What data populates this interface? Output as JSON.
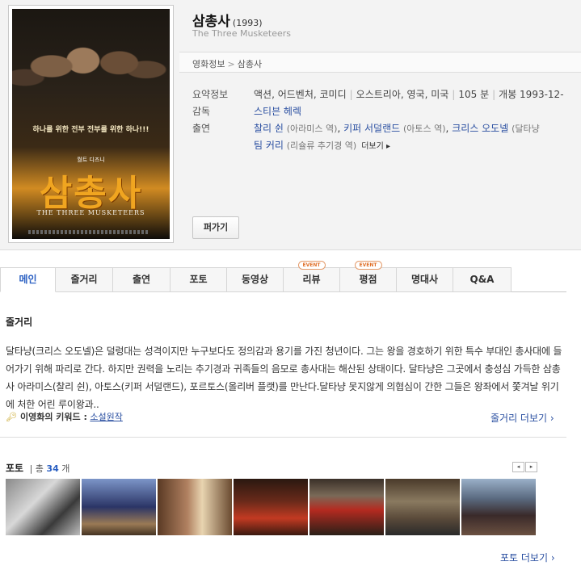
{
  "movie": {
    "title": "삼총사",
    "year": "(1993)",
    "original_title": "The Three Musketeers",
    "poster": {
      "tagline": "하나를 위한 전부 전부를 위한 하나!!!",
      "studio": "월트 디즈니",
      "logo_text": "삼총사",
      "english": "THE THREE MUSKETEERS"
    }
  },
  "breadcrumb": [
    "영화정보",
    "삼총사"
  ],
  "details": {
    "summary_label": "요약정보",
    "summary_items": [
      "액션, 어드벤처, 코미디",
      "오스트리아, 영국, 미국",
      "105 분",
      "개봉 1993-12-"
    ],
    "director_label": "감독",
    "director": "스티븐 헤렉",
    "cast_label": "출연",
    "cast_line1": [
      {
        "name": "찰리 쉰",
        "role": "(아라미스 역)"
      },
      {
        "name": "키퍼 서덜랜드",
        "role": "(아토스 역)"
      },
      {
        "name": "크리스 오도넬",
        "role": "(달타냥"
      }
    ],
    "cast_line2": [
      {
        "name": "팀 커리",
        "role": "(리슐류 추기경 역)"
      }
    ],
    "more_label": "더보기 ▸"
  },
  "share_button": "퍼가기",
  "tabs": [
    {
      "label": "메인",
      "active": true,
      "badge": ""
    },
    {
      "label": "줄거리",
      "active": false,
      "badge": ""
    },
    {
      "label": "출연",
      "active": false,
      "badge": ""
    },
    {
      "label": "포토",
      "active": false,
      "badge": ""
    },
    {
      "label": "동영상",
      "active": false,
      "badge": ""
    },
    {
      "label": "리뷰",
      "active": false,
      "badge": "EVENT"
    },
    {
      "label": "평점",
      "active": false,
      "badge": "EVENT"
    },
    {
      "label": "명대사",
      "active": false,
      "badge": ""
    },
    {
      "label": "Q&A",
      "active": false,
      "badge": ""
    }
  ],
  "synopsis": {
    "heading": "줄거리",
    "text": "달타냥(크리스 오도넬)은 덜렁대는 성격이지만 누구보다도 정의감과 용기를 가진 청년이다. 그는 왕을 경호하기 위한 특수 부대인 총사대에 들어가기 위해 파리로 간다. 하지만 권력을 노리는 추기경과 귀족들의 음모로 총사대는 해산된 상태이다. 달타냥은 그곳에서 충성심 가득한 삼총사 아라미스(찰리 쉰), 아토스(키퍼 서덜랜드), 포르토스(올리버 플랫)를 만난다.달타냥 못지않게 의협심이 간한 그들은 왕좌에서 쫓겨날 위기에 처한 어린 루이왕과..",
    "keyword_label": "이영화의 키워드 :",
    "keyword": "소설원작",
    "more": "줄거리 더보기 ›"
  },
  "photos": {
    "heading": "포토",
    "count_prefix": "총",
    "count": "34",
    "count_suffix": "개",
    "prev": "◂",
    "next": "▸",
    "more": "포토 더보기 ›"
  },
  "colors": {
    "link": "#2a4fa1",
    "active_tab": "#2a5fc2",
    "event_badge": "#e06f28"
  }
}
